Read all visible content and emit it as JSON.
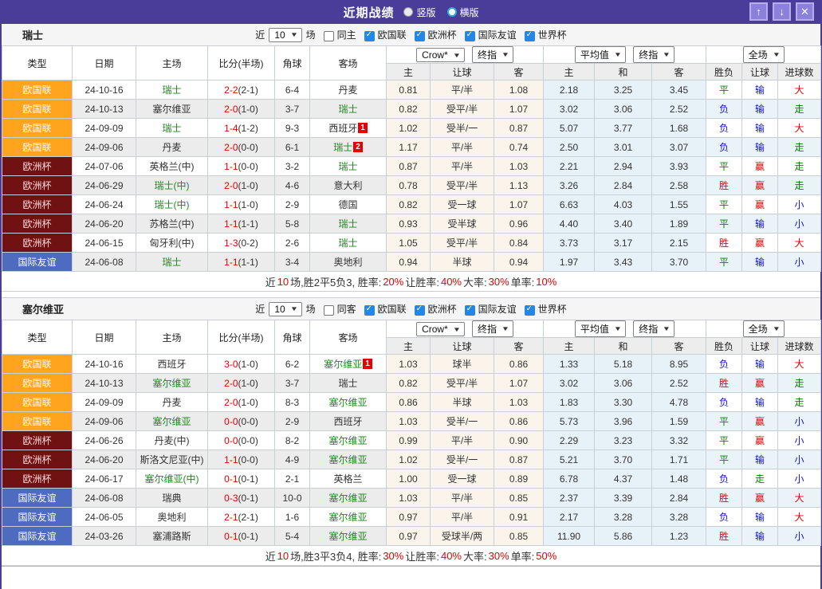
{
  "titlebar": {
    "title": "近期战绩",
    "radio_vertical": "竖版",
    "radio_horizontal": "横版"
  },
  "filters": {
    "near_label": "近",
    "count": "10",
    "games_label": "场",
    "leagues": [
      "欧国联",
      "欧洲杯",
      "国际友谊",
      "世界杯"
    ]
  },
  "header": {
    "cols": [
      "类型",
      "日期",
      "主场",
      "比分(半场)",
      "角球",
      "客场"
    ],
    "crow_select": "Crow*",
    "crow_period_select": "终指",
    "avg_select": "平均值",
    "avg_period_select": "终指",
    "scope_select": "全场",
    "sub_crow": [
      "主",
      "让球",
      "客"
    ],
    "sub_avg": [
      "主",
      "和",
      "客"
    ],
    "result_cols": [
      "胜负",
      "让球",
      "进球数"
    ]
  },
  "colors": {
    "titlebar": "#4a3d99",
    "type_nations_league": "#ffa41c",
    "type_euro": "#701112",
    "type_friendly": "#4d6cc0",
    "win_red": "#e60000",
    "draw_green": "#008000",
    "lose_blue": "#1212cc",
    "team_green": "#1e8a1e"
  },
  "sections": [
    {
      "team": "瑞士",
      "same_label": "同主",
      "rows": [
        {
          "type": "欧国联",
          "date": "24-10-16",
          "home": "瑞士",
          "hg": true,
          "hb": "",
          "score": "2-2",
          "half": "(2-1)",
          "corner": "6-4",
          "away": "丹麦",
          "ag": false,
          "ab": "",
          "odds": [
            "0.81",
            "平/半",
            "1.08"
          ],
          "avg": [
            "2.18",
            "3.25",
            "3.45"
          ],
          "res": [
            "平",
            "输",
            "大"
          ]
        },
        {
          "type": "欧国联",
          "date": "24-10-13",
          "home": "塞尔维亚",
          "hg": false,
          "hb": "",
          "score": "2-0",
          "half": "(1-0)",
          "corner": "3-7",
          "away": "瑞士",
          "ag": true,
          "ab": "",
          "odds": [
            "0.82",
            "受平/半",
            "1.07"
          ],
          "avg": [
            "3.02",
            "3.06",
            "2.52"
          ],
          "res": [
            "负",
            "输",
            "走"
          ]
        },
        {
          "type": "欧国联",
          "date": "24-09-09",
          "home": "瑞士",
          "hg": true,
          "hb": "",
          "score": "1-4",
          "half": "(1-2)",
          "corner": "9-3",
          "away": "西班牙",
          "ag": false,
          "ab": "1",
          "odds": [
            "1.02",
            "受半/一",
            "0.87"
          ],
          "avg": [
            "5.07",
            "3.77",
            "1.68"
          ],
          "res": [
            "负",
            "输",
            "大"
          ]
        },
        {
          "type": "欧国联",
          "date": "24-09-06",
          "home": "丹麦",
          "hg": false,
          "hb": "",
          "score": "2-0",
          "half": "(0-0)",
          "corner": "6-1",
          "away": "瑞士",
          "ag": true,
          "ab": "2",
          "odds": [
            "1.17",
            "平/半",
            "0.74"
          ],
          "avg": [
            "2.50",
            "3.01",
            "3.07"
          ],
          "res": [
            "负",
            "输",
            "走"
          ]
        },
        {
          "type": "欧洲杯",
          "date": "24-07-06",
          "home": "英格兰(中)",
          "hg": false,
          "hb": "",
          "score": "1-1",
          "half": "(0-0)",
          "corner": "3-2",
          "away": "瑞士",
          "ag": true,
          "ab": "",
          "odds": [
            "0.87",
            "平/半",
            "1.03"
          ],
          "avg": [
            "2.21",
            "2.94",
            "3.93"
          ],
          "res": [
            "平",
            "赢",
            "走"
          ]
        },
        {
          "type": "欧洲杯",
          "date": "24-06-29",
          "home": "瑞士(中)",
          "hg": true,
          "hb": "",
          "score": "2-0",
          "half": "(1-0)",
          "corner": "4-6",
          "away": "意大利",
          "ag": false,
          "ab": "",
          "odds": [
            "0.78",
            "受平/半",
            "1.13"
          ],
          "avg": [
            "3.26",
            "2.84",
            "2.58"
          ],
          "res": [
            "胜",
            "赢",
            "走"
          ]
        },
        {
          "type": "欧洲杯",
          "date": "24-06-24",
          "home": "瑞士(中)",
          "hg": true,
          "hb": "",
          "score": "1-1",
          "half": "(1-0)",
          "corner": "2-9",
          "away": "德国",
          "ag": false,
          "ab": "",
          "odds": [
            "0.82",
            "受一球",
            "1.07"
          ],
          "avg": [
            "6.63",
            "4.03",
            "1.55"
          ],
          "res": [
            "平",
            "赢",
            "小"
          ]
        },
        {
          "type": "欧洲杯",
          "date": "24-06-20",
          "home": "苏格兰(中)",
          "hg": false,
          "hb": "",
          "score": "1-1",
          "half": "(1-1)",
          "corner": "5-8",
          "away": "瑞士",
          "ag": true,
          "ab": "",
          "odds": [
            "0.93",
            "受半球",
            "0.96"
          ],
          "avg": [
            "4.40",
            "3.40",
            "1.89"
          ],
          "res": [
            "平",
            "输",
            "小"
          ]
        },
        {
          "type": "欧洲杯",
          "date": "24-06-15",
          "home": "匈牙利(中)",
          "hg": false,
          "hb": "",
          "score": "1-3",
          "half": "(0-2)",
          "corner": "2-6",
          "away": "瑞士",
          "ag": true,
          "ab": "",
          "odds": [
            "1.05",
            "受平/半",
            "0.84"
          ],
          "avg": [
            "3.73",
            "3.17",
            "2.15"
          ],
          "res": [
            "胜",
            "赢",
            "大"
          ]
        },
        {
          "type": "国际友谊",
          "date": "24-06-08",
          "home": "瑞士",
          "hg": true,
          "hb": "",
          "score": "1-1",
          "half": "(1-1)",
          "corner": "3-4",
          "away": "奥地利",
          "ag": false,
          "ab": "",
          "odds": [
            "0.94",
            "半球",
            "0.94"
          ],
          "avg": [
            "1.97",
            "3.43",
            "3.70"
          ],
          "res": [
            "平",
            "输",
            "小"
          ]
        }
      ],
      "summary": [
        {
          "t": "近"
        },
        {
          "t": "10",
          "r": 1
        },
        {
          "t": "场,胜2平5负3, 胜率:"
        },
        {
          "t": "20%",
          "r": 1
        },
        {
          "t": " 让胜率:"
        },
        {
          "t": "40%",
          "r": 1
        },
        {
          "t": " 大率:"
        },
        {
          "t": "30%",
          "r": 1
        },
        {
          "t": " 单率:"
        },
        {
          "t": "10%",
          "r": 1
        }
      ]
    },
    {
      "team": "塞尔维亚",
      "same_label": "同客",
      "rows": [
        {
          "type": "欧国联",
          "date": "24-10-16",
          "home": "西班牙",
          "hg": false,
          "hb": "",
          "score": "3-0",
          "half": "(1-0)",
          "corner": "6-2",
          "away": "塞尔维亚",
          "ag": true,
          "ab": "1",
          "odds": [
            "1.03",
            "球半",
            "0.86"
          ],
          "avg": [
            "1.33",
            "5.18",
            "8.95"
          ],
          "res": [
            "负",
            "输",
            "大"
          ]
        },
        {
          "type": "欧国联",
          "date": "24-10-13",
          "home": "塞尔维亚",
          "hg": true,
          "hb": "",
          "score": "2-0",
          "half": "(1-0)",
          "corner": "3-7",
          "away": "瑞士",
          "ag": false,
          "ab": "",
          "odds": [
            "0.82",
            "受平/半",
            "1.07"
          ],
          "avg": [
            "3.02",
            "3.06",
            "2.52"
          ],
          "res": [
            "胜",
            "赢",
            "走"
          ]
        },
        {
          "type": "欧国联",
          "date": "24-09-09",
          "home": "丹麦",
          "hg": false,
          "hb": "",
          "score": "2-0",
          "half": "(1-0)",
          "corner": "8-3",
          "away": "塞尔维亚",
          "ag": true,
          "ab": "",
          "odds": [
            "0.86",
            "半球",
            "1.03"
          ],
          "avg": [
            "1.83",
            "3.30",
            "4.78"
          ],
          "res": [
            "负",
            "输",
            "走"
          ]
        },
        {
          "type": "欧国联",
          "date": "24-09-06",
          "home": "塞尔维亚",
          "hg": true,
          "hb": "",
          "score": "0-0",
          "half": "(0-0)",
          "corner": "2-9",
          "away": "西班牙",
          "ag": false,
          "ab": "",
          "odds": [
            "1.03",
            "受半/一",
            "0.86"
          ],
          "avg": [
            "5.73",
            "3.96",
            "1.59"
          ],
          "res": [
            "平",
            "赢",
            "小"
          ]
        },
        {
          "type": "欧洲杯",
          "date": "24-06-26",
          "home": "丹麦(中)",
          "hg": false,
          "hb": "",
          "score": "0-0",
          "half": "(0-0)",
          "corner": "8-2",
          "away": "塞尔维亚",
          "ag": true,
          "ab": "",
          "odds": [
            "0.99",
            "平/半",
            "0.90"
          ],
          "avg": [
            "2.29",
            "3.23",
            "3.32"
          ],
          "res": [
            "平",
            "赢",
            "小"
          ]
        },
        {
          "type": "欧洲杯",
          "date": "24-06-20",
          "home": "斯洛文尼亚(中)",
          "hg": false,
          "hb": "",
          "score": "1-1",
          "half": "(0-0)",
          "corner": "4-9",
          "away": "塞尔维亚",
          "ag": true,
          "ab": "",
          "odds": [
            "1.02",
            "受半/一",
            "0.87"
          ],
          "avg": [
            "5.21",
            "3.70",
            "1.71"
          ],
          "res": [
            "平",
            "输",
            "小"
          ]
        },
        {
          "type": "欧洲杯",
          "date": "24-06-17",
          "home": "塞尔维亚(中)",
          "hg": true,
          "hb": "",
          "score": "0-1",
          "half": "(0-1)",
          "corner": "2-1",
          "away": "英格兰",
          "ag": false,
          "ab": "",
          "odds": [
            "1.00",
            "受一球",
            "0.89"
          ],
          "avg": [
            "6.78",
            "4.37",
            "1.48"
          ],
          "res": [
            "负",
            "走",
            "小"
          ]
        },
        {
          "type": "国际友谊",
          "date": "24-06-08",
          "home": "瑞典",
          "hg": false,
          "hb": "",
          "score": "0-3",
          "half": "(0-1)",
          "corner": "10-0",
          "away": "塞尔维亚",
          "ag": true,
          "ab": "",
          "odds": [
            "1.03",
            "平/半",
            "0.85"
          ],
          "avg": [
            "2.37",
            "3.39",
            "2.84"
          ],
          "res": [
            "胜",
            "赢",
            "大"
          ]
        },
        {
          "type": "国际友谊",
          "date": "24-06-05",
          "home": "奥地利",
          "hg": false,
          "hb": "",
          "score": "2-1",
          "half": "(2-1)",
          "corner": "1-6",
          "away": "塞尔维亚",
          "ag": true,
          "ab": "",
          "odds": [
            "0.97",
            "平/半",
            "0.91"
          ],
          "avg": [
            "2.17",
            "3.28",
            "3.28"
          ],
          "res": [
            "负",
            "输",
            "大"
          ]
        },
        {
          "type": "国际友谊",
          "date": "24-03-26",
          "home": "塞浦路斯",
          "hg": false,
          "hb": "",
          "score": "0-1",
          "half": "(0-1)",
          "corner": "5-4",
          "away": "塞尔维亚",
          "ag": true,
          "ab": "",
          "odds": [
            "0.97",
            "受球半/两",
            "0.85"
          ],
          "avg": [
            "11.90",
            "5.86",
            "1.23"
          ],
          "res": [
            "胜",
            "输",
            "小"
          ]
        }
      ],
      "summary": [
        {
          "t": "近"
        },
        {
          "t": "10",
          "r": 1
        },
        {
          "t": "场,胜3平3负4, 胜率:"
        },
        {
          "t": "30%",
          "r": 1
        },
        {
          "t": " 让胜率:"
        },
        {
          "t": "40%",
          "r": 1
        },
        {
          "t": " 大率:"
        },
        {
          "t": "30%",
          "r": 1
        },
        {
          "t": " 单率:"
        },
        {
          "t": "50%",
          "r": 1
        }
      ]
    }
  ]
}
